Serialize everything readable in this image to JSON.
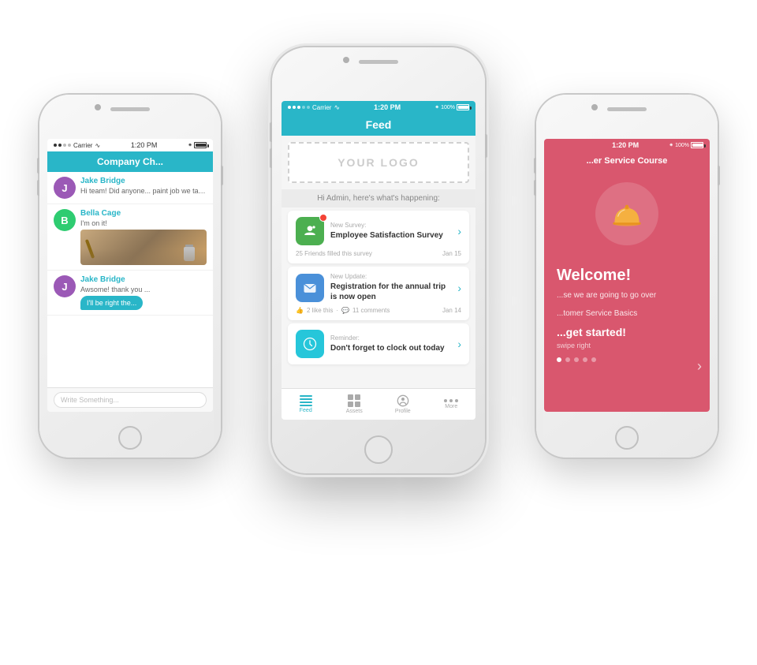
{
  "phones": {
    "left": {
      "status": {
        "carrier": "Carrier",
        "wifi": "WiFi",
        "time": "1:20 PM"
      },
      "header": {
        "title": "Company Ch..."
      },
      "chats": [
        {
          "avatar": "J",
          "avatar_color": "purple",
          "name": "Jake Bridge",
          "message": "Hi team! Did anyone... paint job we talked a..."
        },
        {
          "avatar": "B",
          "avatar_color": "green",
          "name": "Bella Cage",
          "message": "I'm on it!",
          "has_image": true
        },
        {
          "avatar": "J",
          "avatar_color": "purple",
          "name": "Jake Bridge",
          "message": "Awsome! thank you ...",
          "has_bubble": true,
          "bubble_text": "I'll be right the..."
        }
      ],
      "input_placeholder": "Write Something..."
    },
    "center": {
      "status": {
        "carrier": "Carrier",
        "wifi": "WiFi",
        "time": "1:20 PM",
        "battery": "100%"
      },
      "header": {
        "title": "Feed"
      },
      "logo_placeholder": "YOUR LOGO",
      "greeting": "Hi Admin, here's what's happening:",
      "feed_items": [
        {
          "type": "survey",
          "label": "New Survey:",
          "title": "Employee Satisfaction Survey",
          "footer_left": "25 Friends filled this survey",
          "footer_date": "Jan 15",
          "icon_color": "green"
        },
        {
          "type": "update",
          "label": "New Update:",
          "title": "Registration for the annual trip is now open",
          "footer_likes": "2 like this",
          "footer_comments": "11 comments",
          "footer_date": "Jan 14",
          "icon_color": "blue"
        },
        {
          "type": "reminder",
          "label": "Reminder:",
          "title": "Don't forget to clock out today",
          "icon_color": "teal"
        }
      ],
      "nav": {
        "items": [
          {
            "label": "Feed",
            "active": true
          },
          {
            "label": "Assets",
            "active": false
          },
          {
            "label": "Profile",
            "active": false
          },
          {
            "label": "More",
            "active": false
          }
        ]
      }
    },
    "right": {
      "status": {
        "time": "1:20 PM",
        "battery": "100%"
      },
      "header": {
        "title": "...er Service Course"
      },
      "course": {
        "welcome": "Welcome!",
        "description_line1": "...se we are going to go over",
        "description_line2": "...tomer Service Basics",
        "cta": "...get started!",
        "hint": "swipe right"
      },
      "dots": [
        true,
        false,
        false,
        false,
        false
      ],
      "arrow": "›"
    }
  }
}
